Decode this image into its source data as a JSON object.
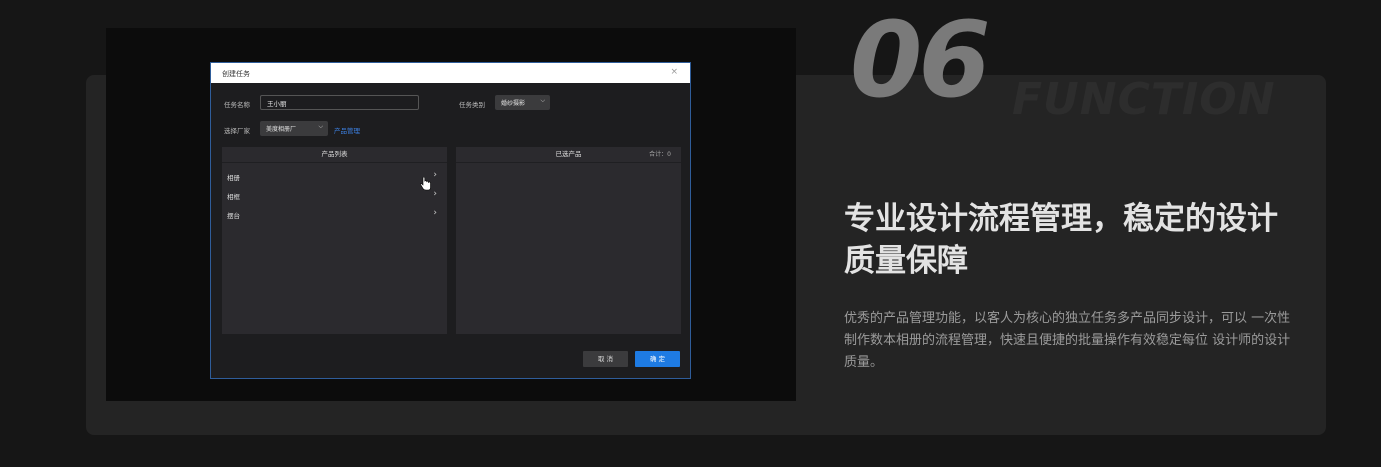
{
  "screenshot": {
    "dialog": {
      "title": "创建任务",
      "close_glyph": "×",
      "task_name_label": "任务名称",
      "task_name_value": "王小丽",
      "task_type_label": "任务类别",
      "task_type_value": "婚纱摄影",
      "factory_label": "选择厂家",
      "factory_value": "美度相册厂",
      "product_manage_link": "产品管理",
      "product_list": {
        "header": "产品列表",
        "items": [
          {
            "label": "相册"
          },
          {
            "label": "相框"
          },
          {
            "label": "摆台"
          }
        ]
      },
      "selected_products": {
        "header": "已选产品",
        "count_text": "合计：0"
      },
      "cancel_label": "取 消",
      "ok_label": "确 定"
    }
  },
  "feature": {
    "number": "06",
    "ghost_word": "FUNCTION",
    "headline": "专业设计流程管理，稳定的设计质量保障",
    "description": "优秀的产品管理功能，以客人为核心的独立任务多产品同步设计，可以 一次性制作数本相册的流程管理，快速且便捷的批量操作有效稳定每位 设计师的设计质量。"
  },
  "colors": {
    "page_bg": "#161616",
    "panel_bg": "#242424",
    "accent_blue": "#1e7be3",
    "link_blue": "#3d82e6"
  },
  "icons": {
    "close": "close-icon",
    "chevron": "chevron-down-icon",
    "arrow": "chevron-right-icon",
    "cursor": "hand-pointer-icon"
  }
}
